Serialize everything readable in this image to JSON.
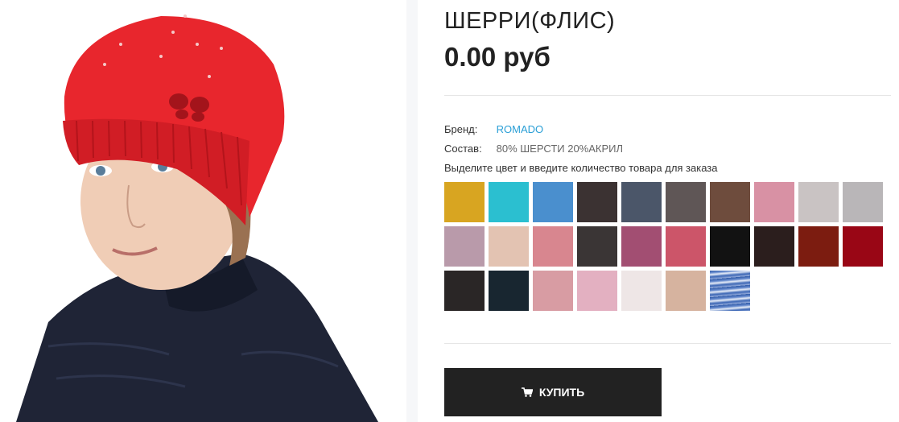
{
  "product": {
    "title": "ШЕРРИ(ФЛИС)",
    "price": "0.00 руб",
    "brand_label": "Бренд:",
    "brand_value": "ROMADO",
    "composition_label": "Состав:",
    "composition_value": "80% ШЕРСТИ 20%АКРИЛ",
    "instruction": "Выделите цвет и введите количество товара для заказа",
    "buy_label": "КУПИТЬ"
  },
  "colors": {
    "accent_link": "#2a9fd6",
    "button_bg": "#222222",
    "hat": "#e8262d",
    "jacket": "#1f2436"
  },
  "swatches": [
    "#d8a521",
    "#2bbfd0",
    "#4a8fce",
    "#3b3232",
    "#4b5669",
    "#5f5656",
    "#6e4c3d",
    "#d891a4",
    "#c9c3c3",
    "#b9b6b8",
    "#b99aaa",
    "#e3c3b2",
    "#d8868f",
    "#3a3535",
    "#a24e72",
    "#cc5569",
    "#121212",
    "#2b1e1d",
    "#7c1c10",
    "#990615",
    "#2a2626",
    "#182630",
    "#d89ca3",
    "#e3b0c1",
    "#eee6e6",
    "#d6b39f",
    "multi-blue"
  ]
}
